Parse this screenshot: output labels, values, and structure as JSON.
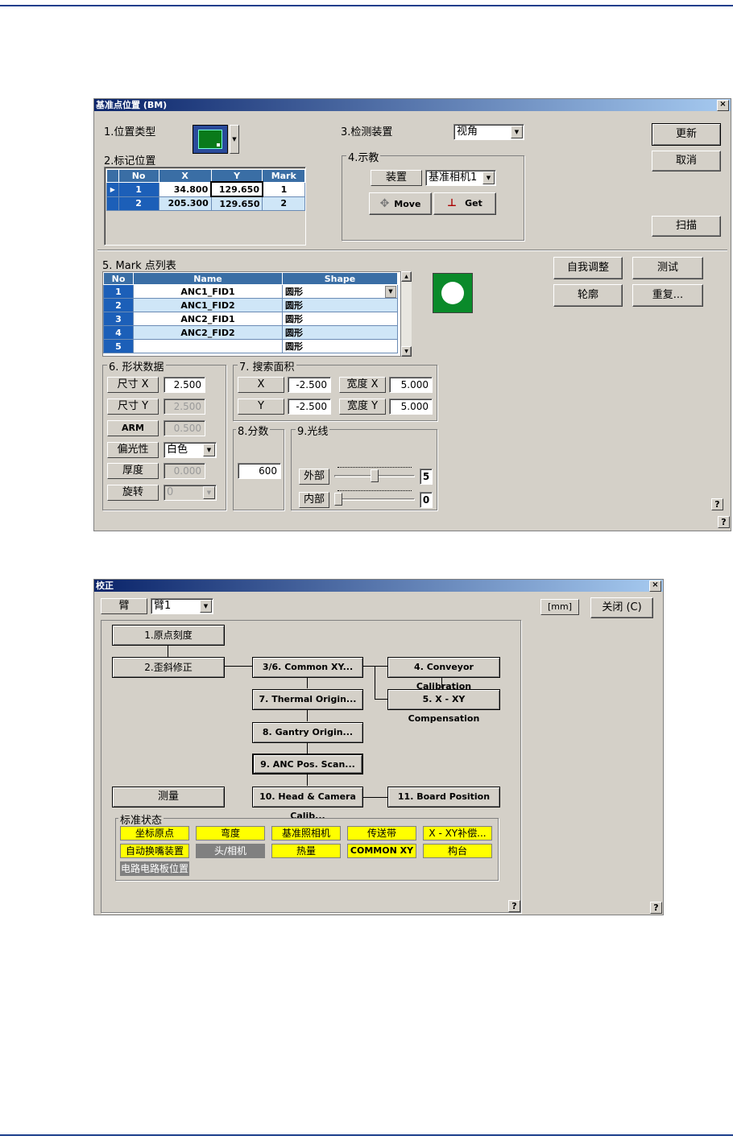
{
  "dialog1": {
    "title": "基准点位置 (BM)",
    "close_glyph": "×",
    "position_type_label": "1.位置类型",
    "mark_position_label": "2.标记位置",
    "mark_table": {
      "headers": [
        "No",
        "X",
        "Y",
        "Mark"
      ],
      "rows": [
        {
          "no": "1",
          "x": "34.800",
          "y": "129.650",
          "mark": "1"
        },
        {
          "no": "2",
          "x": "205.300",
          "y": "129.650",
          "mark": "2"
        }
      ]
    },
    "detect_device_label": "3.检测装置",
    "detect_device_value": "视角",
    "teach_group_label": "4.示教",
    "device_button": "装置",
    "device_value": "基准相机1",
    "move_button": "Move",
    "get_button": "Get",
    "update_button": "更新",
    "cancel_button": "取消",
    "scan_button": "扫描",
    "mark_list_label": "5. Mark 点列表",
    "mark_list": {
      "headers": [
        "No",
        "Name",
        "Shape"
      ],
      "rows": [
        {
          "no": "1",
          "name": "ANC1_FID1",
          "shape": "圆形"
        },
        {
          "no": "2",
          "name": "ANC1_FID2",
          "shape": "圆形"
        },
        {
          "no": "3",
          "name": "ANC2_FID1",
          "shape": "圆形"
        },
        {
          "no": "4",
          "name": "ANC2_FID2",
          "shape": "圆形"
        },
        {
          "no": "5",
          "name": "",
          "shape": "圆形"
        }
      ]
    },
    "self_adjust_button": "自我调整",
    "test_button": "测试",
    "contour_button": "轮廓",
    "repeat_button": "重复...",
    "shape_data": {
      "label": "6. 形状数据",
      "size_x_label": "尺寸 X",
      "size_x": "2.500",
      "size_y_label": "尺寸 Y",
      "size_y": "2.500",
      "arm_label": "ARM",
      "arm": "0.500",
      "polarity_label": "偏光性",
      "polarity": "白色",
      "thickness_label": "厚度",
      "thickness": "0.000",
      "rotation_label": "旋转",
      "rotation": "0"
    },
    "search_area": {
      "label": "7. 搜索面积",
      "x_label": "X",
      "x": "-2.500",
      "width_x_label": "宽度 X",
      "width_x": "5.000",
      "y_label": "Y",
      "y": "-2.500",
      "width_y_label": "宽度 Y",
      "width_y": "5.000"
    },
    "score": {
      "label": "8.分数",
      "value": "600"
    },
    "light": {
      "label": "9.光线",
      "outer_label": "外部",
      "outer_value": "5",
      "outer_level": 5,
      "inner_label": "内部",
      "inner_value": "0",
      "inner_level": 0
    },
    "help_glyph": "?"
  },
  "dialog2": {
    "title": "校正",
    "close_glyph": "×",
    "arm_label": "臂",
    "arm_value": "臂1",
    "unit_label": "[mm]",
    "close_button": "关闭 (C)",
    "flow": {
      "origin_scale": "1.原点刻度",
      "skew_correction": "2.歪斜修正",
      "common_xy": "3/6. Common XY...",
      "conveyor_calibration": "4. Conveyor Calibration",
      "thermal_origin": "7. Thermal Origin...",
      "xy_compensation": "5. X - XY Compensation",
      "gantry_origin": "8. Gantry Origin...",
      "anc_pos_scan": "9. ANC Pos. Scan...",
      "measure": "测量",
      "head_camera_calib": "10. Head & Camera Calib...",
      "board_position": "11. Board Position"
    },
    "status_group_label": "标准状态",
    "status": [
      {
        "label": "坐标原点",
        "state": "yellow"
      },
      {
        "label": "弯度",
        "state": "yellow"
      },
      {
        "label": "基准照相机",
        "state": "yellow"
      },
      {
        "label": "传送带",
        "state": "yellow"
      },
      {
        "label": "X - XY补偿...",
        "state": "yellow"
      },
      {
        "label": "自动换嘴装置",
        "state": "yellow"
      },
      {
        "label": "头/相机",
        "state": "gray"
      },
      {
        "label": "热量",
        "state": "yellow"
      },
      {
        "label": "COMMON XY",
        "state": "yellow"
      },
      {
        "label": "构台",
        "state": "yellow"
      },
      {
        "label": "电路电路板位置",
        "state": "gray"
      }
    ],
    "help_glyph": "?"
  },
  "colors": {
    "rule": "#1c3e8c",
    "dialog_bg": "#d4d0c8",
    "grid_header": "#3a6ea5",
    "status_yellow": "#ffff00",
    "status_gray": "#808080"
  }
}
